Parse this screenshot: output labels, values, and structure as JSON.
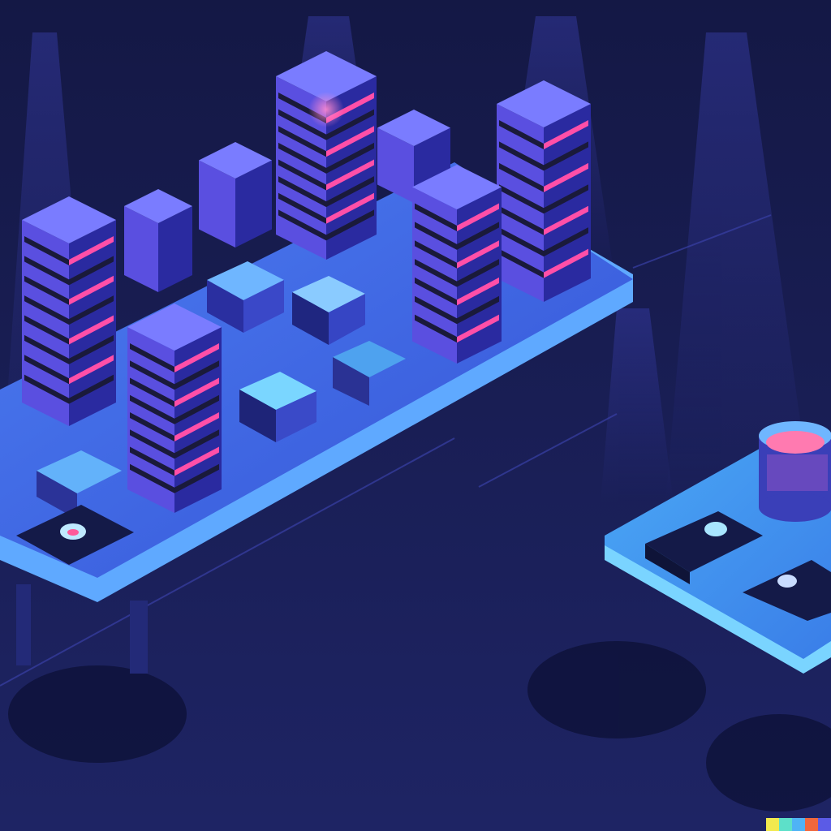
{
  "scene": {
    "description_free": true,
    "palette": {
      "background_top": "#141845",
      "background_bottom": "#1e2464",
      "platform_top": "#3b63e6",
      "platform_edge": "#5fa9ff",
      "building_face_light": "#5a4fe0",
      "building_face_dark": "#2a2aa0",
      "building_top": "#7a7cff",
      "stripe_pink": "#ff4fa8",
      "stripe_dark": "#1a1a3a",
      "glow_cyan": "#5ad4ff",
      "shadow": "#0e1238"
    },
    "signature_colors": [
      "#f2e94e",
      "#5de0c9",
      "#4fb3f5",
      "#f0673c",
      "#5b5be6"
    ]
  }
}
